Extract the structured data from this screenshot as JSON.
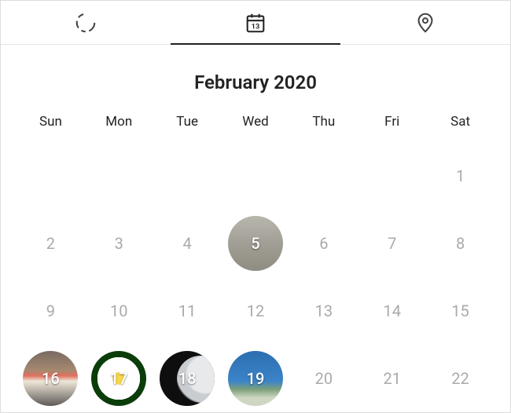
{
  "tabs": {
    "stories_icon": "stories-icon",
    "calendar_icon": "calendar-icon",
    "calendar_badge": "13",
    "location_icon": "location-pin-icon",
    "active": "calendar"
  },
  "month_title": "February 2020",
  "day_headers": [
    "Sun",
    "Mon",
    "Tue",
    "Wed",
    "Thu",
    "Fri",
    "Sat"
  ],
  "weeks": [
    [
      {
        "n": "",
        "b": true
      },
      {
        "n": "",
        "b": true
      },
      {
        "n": "",
        "b": true
      },
      {
        "n": "",
        "b": true
      },
      {
        "n": "",
        "b": true
      },
      {
        "n": "",
        "b": true
      },
      {
        "n": "1"
      }
    ],
    [
      {
        "n": "2"
      },
      {
        "n": "3"
      },
      {
        "n": "4"
      },
      {
        "n": "5",
        "photo": "p5"
      },
      {
        "n": "6"
      },
      {
        "n": "7"
      },
      {
        "n": "8"
      }
    ],
    [
      {
        "n": "9"
      },
      {
        "n": "10"
      },
      {
        "n": "11"
      },
      {
        "n": "12"
      },
      {
        "n": "13"
      },
      {
        "n": "14"
      },
      {
        "n": "15"
      }
    ],
    [
      {
        "n": "16",
        "photo": "p16"
      },
      {
        "n": "17",
        "photo": "p17"
      },
      {
        "n": "18",
        "photo": "p18"
      },
      {
        "n": "19",
        "photo": "p19"
      },
      {
        "n": "20"
      },
      {
        "n": "21"
      },
      {
        "n": "22"
      }
    ]
  ]
}
